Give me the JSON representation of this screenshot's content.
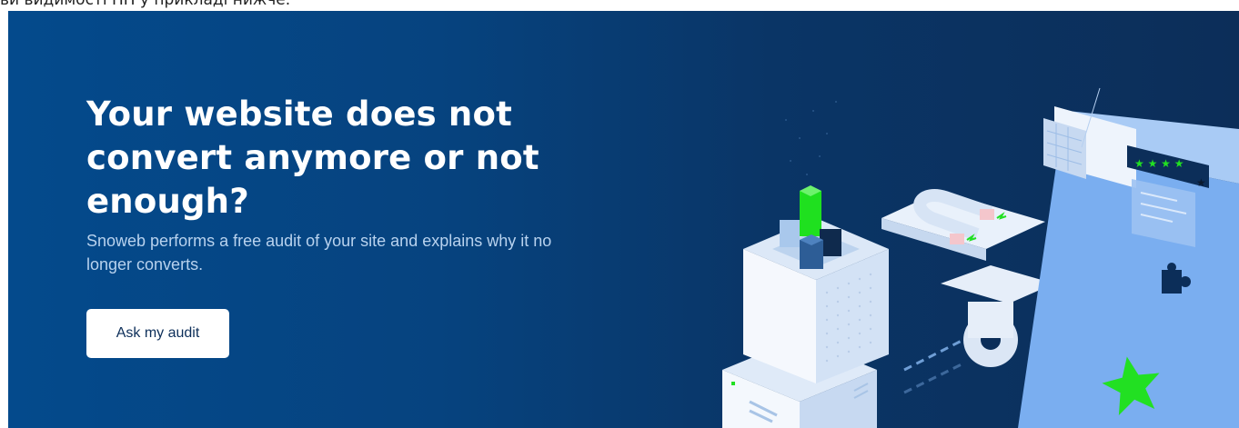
{
  "header": {
    "truncated_text": "ви видимості НП у прикладі нижче."
  },
  "hero": {
    "title": "Your website does not convert anymore or not enough?",
    "subtitle": "Snoweb performs a free audit of your site and explains why it no longer converts.",
    "cta_label": "Ask my audit"
  },
  "colors": {
    "background_start": "#044a8c",
    "background_end": "#0c2e59",
    "accent_green": "#22e022",
    "button_bg": "#ffffff"
  },
  "illustration": {
    "icons": [
      "building-icon",
      "magnet-icon",
      "gear-icon",
      "browser-window-icon",
      "rating-stars-icon",
      "puzzle-icon",
      "star-icon"
    ],
    "rating": {
      "filled": 4,
      "total": 5
    }
  }
}
